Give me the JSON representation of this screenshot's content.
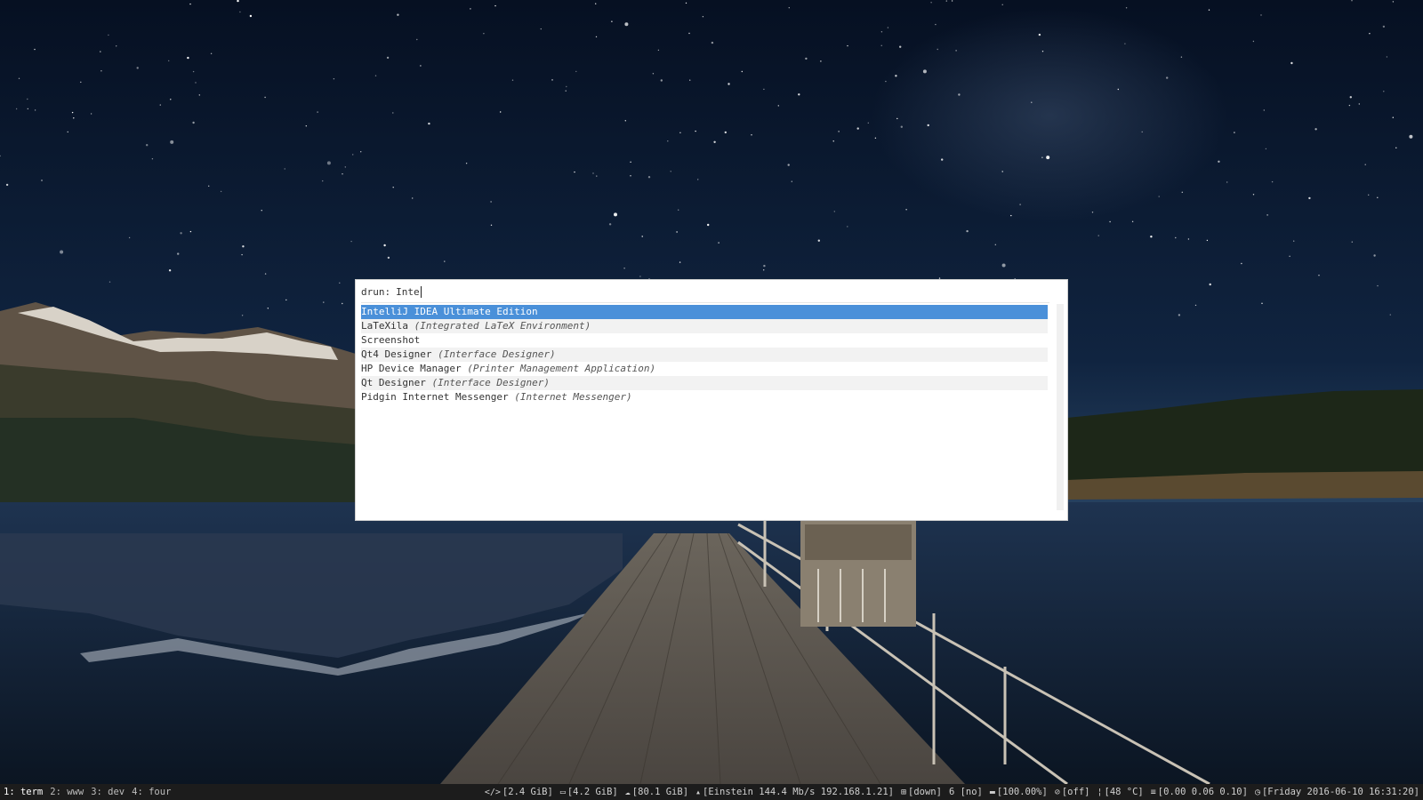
{
  "launcher": {
    "prompt": "drun:",
    "query": "Inte",
    "entries": [
      {
        "name": "IntelliJ IDEA Ultimate Edition",
        "generic": "",
        "selected": true
      },
      {
        "name": "LaTeXila",
        "generic": "(Integrated LaTeX Environment)",
        "selected": false
      },
      {
        "name": "Screenshot",
        "generic": "",
        "selected": false
      },
      {
        "name": "Qt4 Designer",
        "generic": "(Interface Designer)",
        "selected": false
      },
      {
        "name": "HP Device Manager",
        "generic": "(Printer Management Application)",
        "selected": false
      },
      {
        "name": "Qt Designer",
        "generic": "(Interface Designer)",
        "selected": false
      },
      {
        "name": "Pidgin Internet Messenger",
        "generic": "(Internet Messenger)",
        "selected": false
      }
    ],
    "colors": {
      "selected_bg": "#4a90d9",
      "alt_row_bg": "#f2f2f2",
      "background": "#ffffff"
    }
  },
  "statusbar": {
    "workspaces": [
      {
        "label": "1: term",
        "active": true
      },
      {
        "label": "2: www",
        "active": false
      },
      {
        "label": "3: dev",
        "active": false
      },
      {
        "label": "4: four",
        "active": false
      }
    ],
    "blocks": {
      "memory": {
        "icon": "code-icon",
        "text": "[2.4 GiB]"
      },
      "swap": {
        "icon": "memory-chip-icon",
        "text": "[4.2 GiB]"
      },
      "disk": {
        "icon": "disk-icon",
        "text": "[80.1 GiB]"
      },
      "wifi": {
        "icon": "wifi-signal-icon",
        "text": "[Einstein 144.4 Mb/s 192.168.1.21]"
      },
      "ethernet": {
        "icon": "network-icon",
        "text": "[down]"
      },
      "vpn": {
        "text": "6 [no]"
      },
      "battery": {
        "icon": "battery-icon",
        "text": "[100.00%]"
      },
      "dnd": {
        "icon": "disabled-icon",
        "text": "[off]"
      },
      "temperature": {
        "icon": "thermometer-icon",
        "text": "[48 °C]"
      },
      "load": {
        "icon": "load-icon",
        "text": "[0.00 0.06 0.10]"
      },
      "clock": {
        "icon": "clock-icon",
        "text": "[Friday 2016-06-10 16:31:20]"
      }
    },
    "colors": {
      "background": "#1c1c1c",
      "text": "#cfcfcf"
    }
  }
}
